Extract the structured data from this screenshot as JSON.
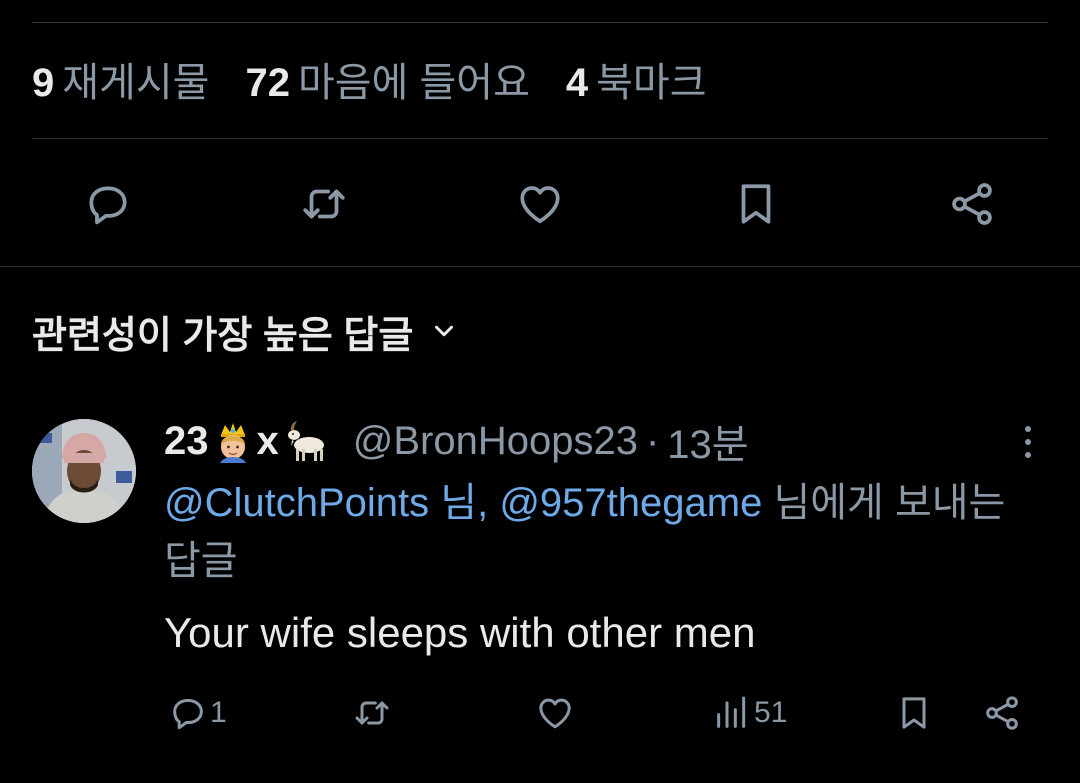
{
  "stats": {
    "reposts": {
      "count": "9",
      "label": "재게시물"
    },
    "likes": {
      "count": "72",
      "label": "마음에 들어요"
    },
    "bookmarks": {
      "count": "4",
      "label": "북마크"
    }
  },
  "actions": [
    "reply-icon",
    "repost-icon",
    "like-icon",
    "bookmark-icon",
    "share-icon"
  ],
  "sort": {
    "label": "관련성이 가장 높은 답글"
  },
  "reply": {
    "name_prefix": "23",
    "name_mid": "x",
    "handle": "@BronHoops23",
    "separator": "·",
    "time": "13분",
    "replying_mention_1": "@ClutchPoints 님,",
    "replying_mention_2": "@957thegame",
    "replying_suffix": " 님에게 보내는 답글",
    "text": "Your wife sleeps with other men",
    "reply_count": "1",
    "views_count": "51"
  },
  "colors": {
    "background": "#000000",
    "text": "#e7e9ea",
    "secondary": "#8b98a5",
    "link": "#6ea9e8",
    "divider": "#2f3336"
  }
}
